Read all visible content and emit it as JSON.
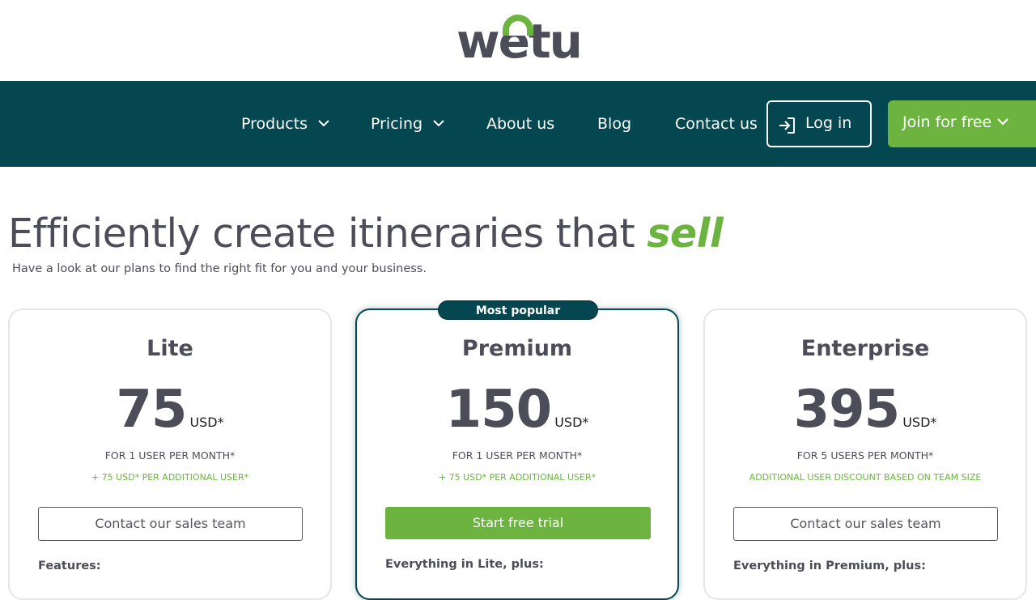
{
  "brand": {
    "logo_text": "wetu",
    "accent_color": "#6cb33f",
    "nav_bg": "#044750"
  },
  "nav": {
    "items": [
      {
        "label": "Products",
        "icon": "chevron-down-icon"
      },
      {
        "label": "Pricing",
        "icon": "chevron-down-icon"
      },
      {
        "label": "About us"
      },
      {
        "label": "Blog"
      },
      {
        "label": "Contact us"
      }
    ],
    "login_label": "Log in",
    "login_icon": "sign-in-icon",
    "join_label": "Join for free",
    "join_icon": "chevron-down-icon"
  },
  "hero": {
    "headline": "Efficiently create itineraries that",
    "headline_accent": "sell",
    "subhead": "Have a look at our plans to find the right fit for you and your business."
  },
  "plans": [
    {
      "name": "Lite",
      "price": "75",
      "currency": "USD*",
      "per_user": "FOR 1 USER PER MONTH*",
      "extra": "+ 75 USD* PER ADDITIONAL USER*",
      "cta": "Contact our sales team",
      "features_label": "Features:"
    },
    {
      "name": "Premium",
      "badge": "Most popular",
      "price": "150",
      "currency": "USD*",
      "per_user": "FOR 1 USER PER MONTH*",
      "extra": "+ 75 USD* PER ADDITIONAL USER*",
      "cta": "Start free trial",
      "features_label": "Everything in Lite, plus:"
    },
    {
      "name": "Enterprise",
      "price": "395",
      "currency": "USD*",
      "per_user": "FOR 5 USERS PER MONTH*",
      "extra": "ADDITIONAL USER DISCOUNT BASED ON TEAM SIZE",
      "cta": "Contact our sales team",
      "features_label": "Everything in Premium, plus:"
    }
  ]
}
